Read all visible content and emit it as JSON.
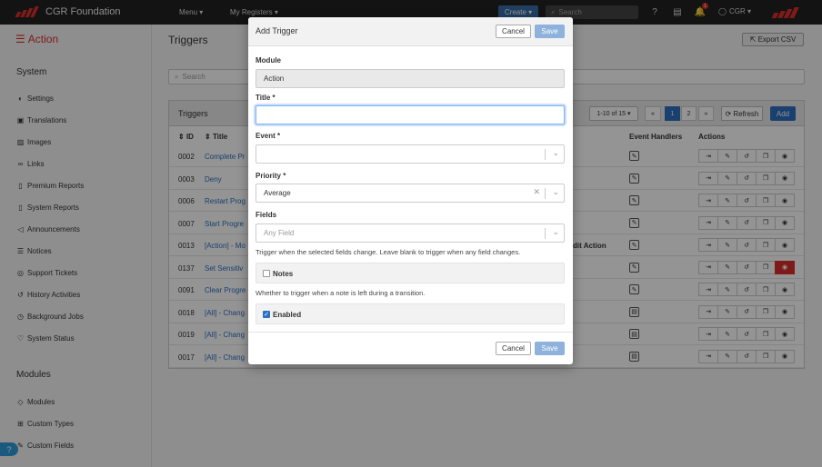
{
  "topbar": {
    "brand": "CGR Foundation",
    "menu": "Menu ▾",
    "registers": "My Registers ▾",
    "create": "Create ▾",
    "search_placeholder": "Search",
    "notif_count": "1",
    "user": "CGR ▾"
  },
  "sidebar": {
    "title": "Action",
    "section_system": "System",
    "system_items": [
      {
        "label": "Settings",
        "icon": "toggle-icon"
      },
      {
        "label": "Translations",
        "icon": "translate-icon"
      },
      {
        "label": "Images",
        "icon": "image-icon"
      },
      {
        "label": "Links",
        "icon": "link-icon"
      },
      {
        "label": "Premium Reports",
        "icon": "report-icon"
      },
      {
        "label": "System Reports",
        "icon": "report-icon"
      },
      {
        "label": "Announcements",
        "icon": "megaphone-icon"
      },
      {
        "label": "Notices",
        "icon": "list-icon"
      },
      {
        "label": "Support Tickets",
        "icon": "support-icon"
      },
      {
        "label": "History Activities",
        "icon": "history-icon"
      },
      {
        "label": "Background Jobs",
        "icon": "jobs-icon"
      },
      {
        "label": "System Status",
        "icon": "heartbeat-icon"
      }
    ],
    "section_modules": "Modules",
    "module_items": [
      {
        "label": "Modules",
        "icon": "cube-icon"
      },
      {
        "label": "Custom Types",
        "icon": "sitemap-icon"
      },
      {
        "label": "Custom Fields",
        "icon": "fields-icon"
      }
    ]
  },
  "main": {
    "title": "Triggers",
    "export": "Export CSV",
    "search_placeholder": "Search",
    "panel_title": "Triggers",
    "pager_info": "1-10 of 15 ▾",
    "pages": [
      "«",
      "1",
      "2",
      "»"
    ],
    "refresh": "Refresh",
    "add": "Add",
    "headers": {
      "id": "ID",
      "title": "Title",
      "event_handlers": "Event Handlers",
      "actions": "Actions"
    },
    "rows": [
      {
        "id": "0002",
        "title": "Complete Pr",
        "extra": ""
      },
      {
        "id": "0003",
        "title": "Deny",
        "extra": ""
      },
      {
        "id": "0006",
        "title": "Restart Prog",
        "extra": ""
      },
      {
        "id": "0007",
        "title": "Start Progre",
        "extra": ""
      },
      {
        "id": "0013",
        "title": "[Action] - Mo",
        "extra": "dit Action"
      },
      {
        "id": "0137",
        "title": "Set Sensitiv",
        "extra": ""
      },
      {
        "id": "0091",
        "title": "Clear Progre",
        "extra": ""
      },
      {
        "id": "0018",
        "title": "[All] - Chang",
        "extra": ""
      },
      {
        "id": "0019",
        "title": "[All] - Chang",
        "extra": ""
      },
      {
        "id": "0017",
        "title": "[All] - Chang",
        "extra": ""
      }
    ]
  },
  "modal": {
    "title": "Add Trigger",
    "cancel": "Cancel",
    "save": "Save",
    "module_label": "Module",
    "module_value": "Action",
    "title_label": "Title *",
    "title_value": "",
    "event_label": "Event *",
    "event_value": "",
    "priority_label": "Priority *",
    "priority_value": "Average",
    "fields_label": "Fields",
    "fields_placeholder": "Any Field",
    "fields_help": "Trigger when the selected fields change. Leave blank to trigger when any field changes.",
    "notes_label": "Notes",
    "notes_checked": false,
    "notes_help": "Whether to trigger when a note is left during a transition.",
    "enabled_label": "Enabled",
    "enabled_checked": true
  },
  "colors": {
    "accent": "#d9302b",
    "primary": "#2d6fc0",
    "save_disabled": "#8eb2dc"
  }
}
